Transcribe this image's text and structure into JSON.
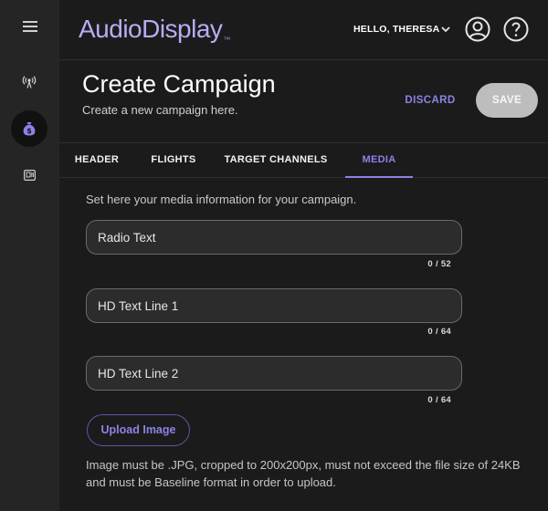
{
  "app": {
    "logo_text": "AudioDisplay",
    "logo_mark": "™"
  },
  "header": {
    "greeting": "HELLO, THERESA"
  },
  "rail": {
    "items": [
      {
        "icon": "broadcast-icon"
      },
      {
        "icon": "money-bag-icon",
        "active": true
      },
      {
        "icon": "media-player-icon"
      }
    ]
  },
  "page": {
    "title": "Create Campaign",
    "subtitle": "Create a new campaign here.",
    "discard_label": "DISCARD",
    "save_label": "SAVE"
  },
  "tabs": [
    {
      "label": "HEADER"
    },
    {
      "label": "FLIGHTS"
    },
    {
      "label": "TARGET CHANNELS"
    },
    {
      "label": "MEDIA",
      "active": true
    }
  ],
  "media": {
    "intro": "Set here your media information for your campaign.",
    "fields": [
      {
        "placeholder": "Radio Text",
        "value": "",
        "counter": "0 / 52"
      },
      {
        "placeholder": "HD Text Line 1",
        "value": "",
        "counter": "0 / 64"
      },
      {
        "placeholder": "HD Text Line 2",
        "value": "",
        "counter": "0 / 64"
      }
    ],
    "upload_label": "Upload Image",
    "note": "Image must be .JPG, cropped to 200x200px, must not exceed the file size of 24KB and must be Baseline format in order to upload."
  },
  "colors": {
    "accent": "#8b83e6",
    "logo": "#b6adf3",
    "background": "#1b1b1b",
    "rail": "#252525"
  }
}
